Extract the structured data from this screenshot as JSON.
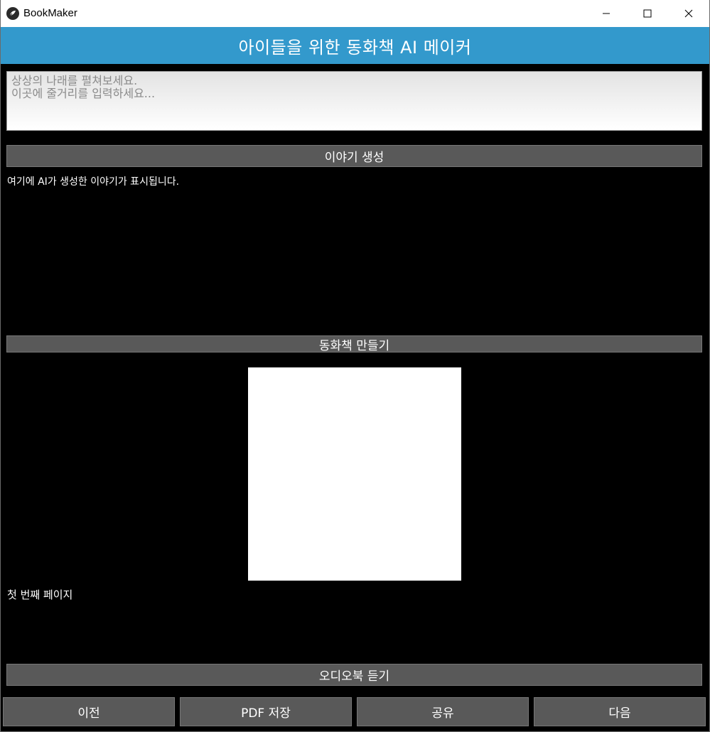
{
  "window": {
    "title": "BookMaker"
  },
  "header": {
    "title": "아이들을 위한 동화책 AI 메이커"
  },
  "story_input": {
    "placeholder": "상상의 나래를 펼쳐보세요.\n 이곳에 줄거리를 입력하세요...",
    "value": ""
  },
  "buttons": {
    "generate_story": "이야기 생성",
    "make_storybook": "동화책 만들기",
    "listen_audiobook": "오디오북 듣기",
    "previous": "이전",
    "save_pdf": "PDF 저장",
    "share": "공유",
    "next": "다음"
  },
  "story_output": {
    "text": "여기에 AI가 생성한 이야기가 표시됩니다."
  },
  "page": {
    "text": "첫 번째 페이지"
  },
  "colors": {
    "header": "#3399cc",
    "button": "#595959",
    "background": "#000000"
  },
  "icons": {
    "app": "kivy-logo-icon",
    "minimize": "minimize-icon",
    "maximize": "maximize-icon",
    "close": "close-icon"
  }
}
